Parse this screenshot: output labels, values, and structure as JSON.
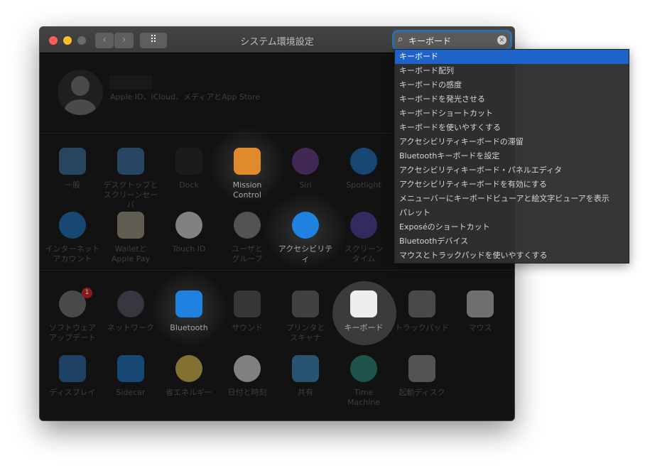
{
  "window": {
    "title": "システム環境設定"
  },
  "toolbar": {
    "back": "‹",
    "forward": "›",
    "grid": "⠿"
  },
  "search": {
    "value": "キーボード",
    "icon": "magnifier-icon",
    "clear": "×"
  },
  "account": {
    "subtitle": "Apple ID、iCloud、メディアとApp Store"
  },
  "colors": {
    "accent": "#1f63c9",
    "close": "#fe5f57",
    "minimize": "#febc2e"
  },
  "rows": [
    [
      {
        "label": "一般",
        "icon": "general-icon",
        "color": "#3a6fa0"
      },
      {
        "label": "デスクトップと\nスクリーンセーバ",
        "icon": "desktop-icon",
        "color": "#3a6fa8"
      },
      {
        "label": "Dock",
        "icon": "dock-icon",
        "color": "#222"
      },
      {
        "label": "Mission\nControl",
        "icon": "mission-control-icon",
        "color": "#e08a2c",
        "lit": true
      },
      {
        "label": "Siri",
        "icon": "siri-icon",
        "color": "#6a3a8a",
        "round": true
      },
      {
        "label": "Spotlight",
        "icon": "spotlight-icon",
        "color": "#1b74c4",
        "round": true
      }
    ],
    [
      {
        "label": "インターネット\nアカウント",
        "icon": "at-icon",
        "color": "#1b74c4",
        "round": true
      },
      {
        "label": "Walletと\nApple Pay",
        "icon": "wallet-icon",
        "color": "#a09a86"
      },
      {
        "label": "Touch ID",
        "icon": "fingerprint-icon",
        "color": "#ddd",
        "round": true
      },
      {
        "label": "ユーザと\nグループ",
        "icon": "users-icon",
        "color": "#888",
        "round": true
      },
      {
        "label": "アクセシビリティ",
        "icon": "accessibility-icon",
        "color": "#1f82e0",
        "round": true,
        "lit": true
      },
      {
        "label": "スクリーン\nタイム",
        "icon": "hourglass-icon",
        "color": "#4a3fa0",
        "round": true
      }
    ],
    [
      {
        "label": "ソフトウェア\nアップデート",
        "icon": "gear-icon",
        "color": "#777",
        "round": true,
        "badge": "1"
      },
      {
        "label": "ネットワーク",
        "icon": "globe-icon",
        "color": "#556",
        "round": true
      },
      {
        "label": "Bluetooth",
        "icon": "bluetooth-icon",
        "color": "#1f82e0",
        "lit": true
      },
      {
        "label": "サウンド",
        "icon": "speaker-icon",
        "color": "#555"
      },
      {
        "label": "プリンタと\nスキャナ",
        "icon": "printer-icon",
        "color": "#666"
      },
      {
        "label": "キーボード",
        "icon": "keyboard-icon",
        "color": "#eee",
        "lit": true
      },
      {
        "label": "トラックパッド",
        "icon": "trackpad-icon",
        "color": "#777"
      },
      {
        "label": "マウス",
        "icon": "mouse-icon",
        "color": "#bbb"
      }
    ],
    [
      {
        "label": "ディスプレイ",
        "icon": "display-icon",
        "color": "#2a6aa8"
      },
      {
        "label": "Sidecar",
        "icon": "sidecar-icon",
        "color": "#1b74c4"
      },
      {
        "label": "省エネルギー",
        "icon": "bulb-icon",
        "color": "#e0c050",
        "round": true
      },
      {
        "label": "日付と時刻",
        "icon": "clock-icon",
        "color": "#ddd",
        "round": true
      },
      {
        "label": "共有",
        "icon": "folder-icon",
        "color": "#3a8ac0"
      },
      {
        "label": "Time\nMachine",
        "icon": "time-machine-icon",
        "color": "#2a8a80",
        "round": true
      },
      {
        "label": "起動ディスク",
        "icon": "disk-icon",
        "color": "#888"
      }
    ]
  ],
  "results": [
    "キーボード",
    "キーボード配列",
    "キーボードの感度",
    "キーボードを発光させる",
    "キーボードショートカット",
    "キーボードを使いやすくする",
    "アクセシビリティキーボードの滞留",
    "Bluetoothキーボードを設定",
    "アクセシビリティキーボード・パネルエディタ",
    "アクセシビリティキーボードを有効にする",
    "メニューバーにキーボードビューアと絵文字ビューアを表示",
    "パレット",
    "Exposéのショートカット",
    "Bluetoothデバイス",
    "マウスとトラックパッドを使いやすくする"
  ]
}
